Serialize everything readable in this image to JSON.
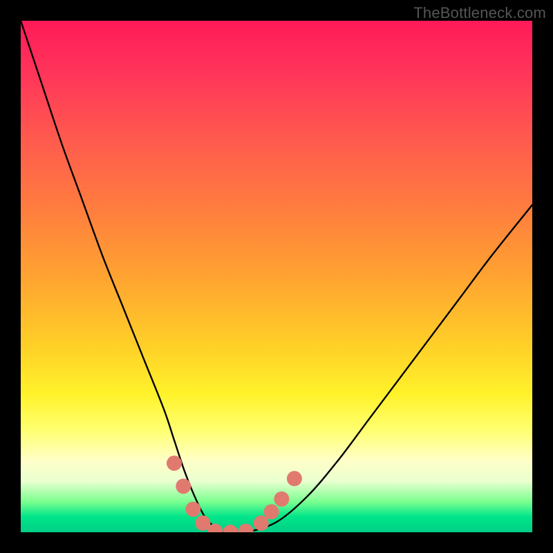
{
  "watermark": "TheBottleneck.com",
  "chart_data": {
    "type": "line",
    "title": "",
    "xlabel": "",
    "ylabel": "",
    "xlim": [
      0,
      100
    ],
    "ylim": [
      0,
      100
    ],
    "grid": false,
    "legend": false,
    "series": [
      {
        "name": "bottleneck-curve",
        "x": [
          0,
          4,
          8,
          12,
          16,
          20,
          24,
          28,
          30,
          32,
          34,
          36,
          38,
          40,
          44,
          50,
          56,
          62,
          68,
          74,
          80,
          86,
          92,
          100
        ],
        "y": [
          100,
          88,
          76,
          65,
          54,
          44,
          34,
          24,
          18,
          12,
          7,
          3,
          1,
          0,
          0,
          2,
          7,
          14,
          22,
          30,
          38,
          46,
          54,
          64
        ],
        "color": "#000000"
      }
    ],
    "markers": [
      {
        "name": "valley-marker",
        "x": 30.0,
        "y": 13.5,
        "color": "#e07a6f"
      },
      {
        "name": "valley-marker",
        "x": 31.8,
        "y": 9.0,
        "color": "#e07a6f"
      },
      {
        "name": "valley-marker",
        "x": 33.7,
        "y": 4.5,
        "color": "#e07a6f"
      },
      {
        "name": "valley-marker",
        "x": 35.6,
        "y": 1.8,
        "color": "#e07a6f"
      },
      {
        "name": "valley-marker",
        "x": 38.0,
        "y": 0.2,
        "color": "#e07a6f"
      },
      {
        "name": "valley-marker",
        "x": 41.0,
        "y": 0.0,
        "color": "#e07a6f"
      },
      {
        "name": "valley-marker",
        "x": 44.0,
        "y": 0.2,
        "color": "#e07a6f"
      },
      {
        "name": "valley-marker",
        "x": 47.0,
        "y": 1.8,
        "color": "#e07a6f"
      },
      {
        "name": "valley-marker",
        "x": 49.0,
        "y": 4.0,
        "color": "#e07a6f"
      },
      {
        "name": "valley-marker",
        "x": 51.0,
        "y": 6.5,
        "color": "#e07a6f"
      },
      {
        "name": "valley-marker",
        "x": 53.5,
        "y": 10.5,
        "color": "#e07a6f"
      }
    ],
    "gradient_stops": [
      {
        "pos": 0,
        "color": "#ff1a58"
      },
      {
        "pos": 10,
        "color": "#ff345a"
      },
      {
        "pos": 23,
        "color": "#ff5a4e"
      },
      {
        "pos": 36,
        "color": "#ff7b3f"
      },
      {
        "pos": 50,
        "color": "#ffa331"
      },
      {
        "pos": 63,
        "color": "#ffce28"
      },
      {
        "pos": 73,
        "color": "#fff22a"
      },
      {
        "pos": 80,
        "color": "#ffff70"
      },
      {
        "pos": 86,
        "color": "#ffffc8"
      },
      {
        "pos": 90,
        "color": "#eaffd0"
      },
      {
        "pos": 94,
        "color": "#7bff8f"
      },
      {
        "pos": 97,
        "color": "#00e58a"
      },
      {
        "pos": 100,
        "color": "#00cf85"
      }
    ]
  }
}
